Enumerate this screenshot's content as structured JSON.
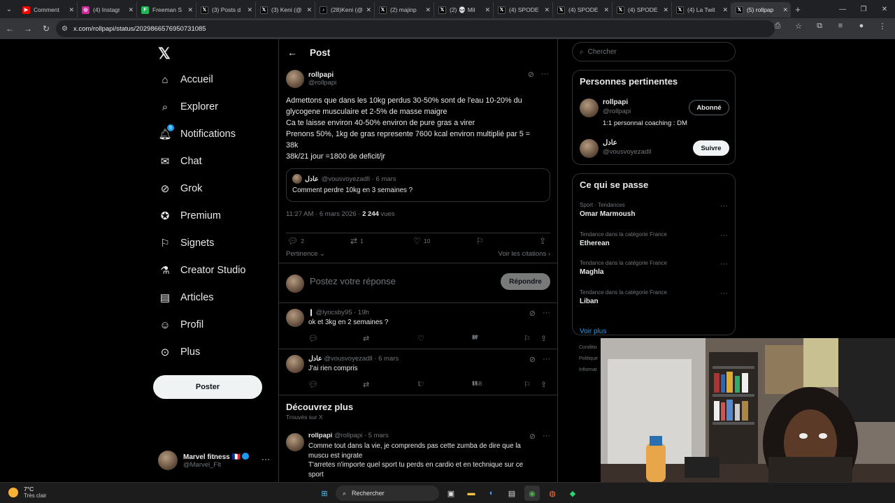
{
  "browser": {
    "tabs": [
      {
        "label": "Comment",
        "icon": "youtube-icon",
        "color": "#ff0000",
        "glyph": "▶"
      },
      {
        "label": "(4) Instagr",
        "icon": "instagram-icon",
        "color": "#d6249f",
        "glyph": "◎"
      },
      {
        "label": "Freeman S",
        "icon": "green-app-icon",
        "color": "#1db954",
        "glyph": "F"
      },
      {
        "label": "(3) Posts d",
        "icon": "x-icon",
        "color": "#000000",
        "glyph": "𝕏"
      },
      {
        "label": "(3) Keni (@",
        "icon": "x-icon",
        "color": "#000000",
        "glyph": "𝕏"
      },
      {
        "label": "(28)Keni (@",
        "icon": "tiktok-icon",
        "color": "#000000",
        "glyph": "♪"
      },
      {
        "label": "(2) majinp",
        "icon": "x-icon",
        "color": "#000000",
        "glyph": "𝕏"
      },
      {
        "label": "(2) 💀 Mil",
        "icon": "x-icon",
        "color": "#000000",
        "glyph": "𝕏"
      },
      {
        "label": "(4) SPODE",
        "icon": "x-icon",
        "color": "#000000",
        "glyph": "𝕏"
      },
      {
        "label": "(4) SPODE",
        "icon": "x-icon",
        "color": "#000000",
        "glyph": "𝕏"
      },
      {
        "label": "(4) SPODE",
        "icon": "x-icon",
        "color": "#000000",
        "glyph": "𝕏"
      },
      {
        "label": "(4) La Twit",
        "icon": "x-icon",
        "color": "#000000",
        "glyph": "𝕏"
      },
      {
        "label": "(5) rollpap",
        "icon": "x-icon",
        "color": "#000000",
        "glyph": "𝕏",
        "active": true
      }
    ],
    "url": "x.com/rollpapi/status/2029866576950731085"
  },
  "sidebar": {
    "logo": "𝕏",
    "items": [
      {
        "label": "Accueil",
        "icon": "home-icon"
      },
      {
        "label": "Explorer",
        "icon": "search-icon"
      },
      {
        "label": "Notifications",
        "icon": "bell-icon",
        "badge": "5"
      },
      {
        "label": "Chat",
        "icon": "mail-icon"
      },
      {
        "label": "Grok",
        "icon": "grok-icon"
      },
      {
        "label": "Premium",
        "icon": "premium-icon"
      },
      {
        "label": "Signets",
        "icon": "bookmark-icon"
      },
      {
        "label": "Creator Studio",
        "icon": "flask-icon"
      },
      {
        "label": "Articles",
        "icon": "article-icon"
      },
      {
        "label": "Profil",
        "icon": "profile-icon"
      },
      {
        "label": "Plus",
        "icon": "more-circle-icon"
      }
    ],
    "post_button": "Poster",
    "account": {
      "name": "Marvel fitness 🇫🇷",
      "handle": "@Marvel_Flt",
      "more": "···"
    }
  },
  "post": {
    "header_title": "Post",
    "author_name": "rollpapi",
    "author_handle": "@rollpapi",
    "body_lines": [
      "Admettons que dans les 10kg perdus 30-50% sont de l'eau 10-20% du",
      "glycogene musculaire et 2-5% de masse maigre",
      "Ca te laisse environ 40-50% environ de pure gras a virer",
      "Prenons 50%, 1kg de gras represente 7600 kcal environ multiplié par 5 =",
      "38k",
      "38k/21 jour =1800 de deficit/jr"
    ],
    "quote": {
      "name": "عادل",
      "meta": "@vousvoyezadll · 6 mars",
      "text": "Comment perdre 10kg en 3 semaines ?"
    },
    "timestamp": "11:27 AM · 6 mars 2026 · ",
    "views_count": "2 244",
    "views_label": " vues",
    "actions": {
      "replies": "2",
      "reposts": "1",
      "likes": "10"
    },
    "sort_label": "Pertinence",
    "quotes_link": "Voir les citations ›",
    "reply_placeholder": "Postez votre réponse",
    "reply_button": "Répondre"
  },
  "comments": [
    {
      "name": "❙",
      "meta": "@lyricsby95 · 19h",
      "text": "ok et 3kg en 2 semaines ?",
      "replies": "",
      "reposts": "",
      "likes": "",
      "views": "37"
    },
    {
      "name": "عادل",
      "meta": "@vousvoyezadll · 6 mars",
      "text": "J'ai rien compris",
      "replies": "",
      "reposts": "",
      "likes": "1",
      "views": "158"
    }
  ],
  "discover": {
    "title": "Découvrez plus",
    "subtitle": "Trouvés sur X",
    "post": {
      "name": "rollpapi",
      "meta": "@rollpapi · 5 mars",
      "lines": [
        "Comme tout dans la vie, je comprends pas cette zumba de dire que la",
        "muscu est ingrate",
        "T'arretes n'importe quel sport tu perds en cardio et en technique sur ce",
        "sport"
      ]
    }
  },
  "right": {
    "search_placeholder": "Chercher",
    "relevant_title": "Personnes pertinentes",
    "people": [
      {
        "name": "rollpapi",
        "handle": "@rollpapi",
        "bio": "1:1 personnal coaching : DM",
        "button": "Abonné"
      },
      {
        "name": "عادل",
        "handle": "@vousvoyezadll",
        "bio": "",
        "button": "Suivre"
      }
    ],
    "trends_title": "Ce qui se passe",
    "trends": [
      {
        "category": "Sport · Tendances",
        "name": "Omar Marmoush"
      },
      {
        "category": "Tendance dans la catégorie France",
        "name": "Etherean"
      },
      {
        "category": "Tendance dans la catégorie France",
        "name": "Maghla"
      },
      {
        "category": "Tendance dans la catégorie France",
        "name": "Liban"
      }
    ],
    "see_more": "Voir plus",
    "footer_links": [
      "Conditio",
      "Politique",
      "Informat"
    ]
  },
  "taskbar": {
    "temp": "7°C",
    "condition": "Très clair",
    "search_label": "Rechercher"
  }
}
